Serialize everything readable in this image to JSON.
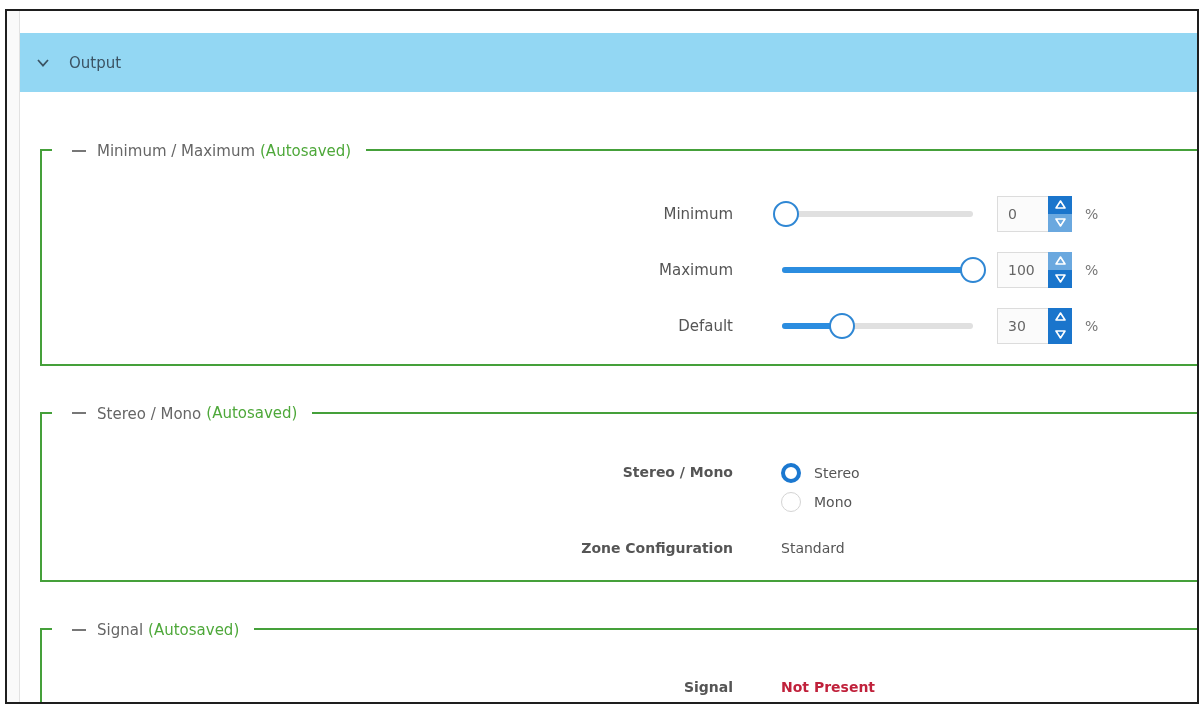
{
  "panel": {
    "title": "Output",
    "expanded": true
  },
  "sections": [
    {
      "title": "Minimum / Maximum",
      "status": "(Autosaved)",
      "expanded": true,
      "rows": [
        {
          "kind": "slider",
          "label": "Minimum",
          "level": 0,
          "value": "0",
          "unit": "%",
          "up_disabled": false,
          "down_disabled": true
        },
        {
          "kind": "slider",
          "label": "Maximum",
          "level": 1,
          "value": "100",
          "unit": "%",
          "up_disabled": true,
          "down_disabled": false
        },
        {
          "kind": "slider",
          "label": "Default",
          "level": 0.3,
          "value": "30",
          "unit": "%",
          "up_disabled": false,
          "down_disabled": false
        }
      ]
    },
    {
      "title": "Stereo / Mono",
      "status": "(Autosaved)",
      "expanded": true,
      "rows": [
        {
          "kind": "radio",
          "label": "Stereo / Mono",
          "options": [
            {
              "label": "Stereo",
              "selected": true
            },
            {
              "label": "Mono",
              "selected": false
            }
          ]
        },
        {
          "kind": "text",
          "label": "Zone Configuration",
          "value": "Standard"
        }
      ]
    },
    {
      "title": "Signal",
      "status": "(Autosaved)",
      "expanded": true,
      "rows": [
        {
          "kind": "status",
          "label": "Signal",
          "value": "Not Present"
        }
      ]
    }
  ]
}
